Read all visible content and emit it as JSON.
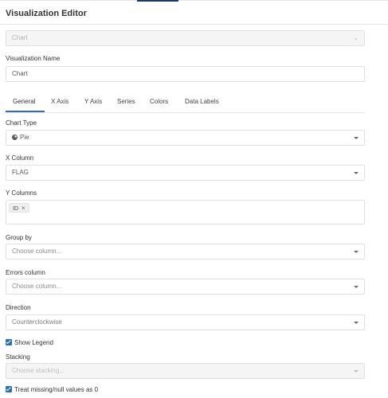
{
  "header": {
    "title": "Visualization Editor"
  },
  "query_result_select": {
    "value": "Chart"
  },
  "name_field": {
    "label": "Visualization Name",
    "value": "Chart"
  },
  "tabs": [
    {
      "label": "General",
      "active": true
    },
    {
      "label": "X Axis"
    },
    {
      "label": "Y Axis"
    },
    {
      "label": "Series"
    },
    {
      "label": "Colors"
    },
    {
      "label": "Data Labels"
    }
  ],
  "chart_type": {
    "label": "Chart Type",
    "value": "Pie",
    "icon": "pie-chart-icon"
  },
  "x_column": {
    "label": "X Column",
    "value": "FLAG"
  },
  "y_columns": {
    "label": "Y Columns",
    "tags": [
      "ID"
    ],
    "remove_symbol": "×"
  },
  "group_by": {
    "label": "Group by",
    "placeholder": "Choose column..."
  },
  "errors_column": {
    "label": "Errors column",
    "placeholder": "Choose column..."
  },
  "direction": {
    "label": "Direction",
    "value": "Counterclockwise"
  },
  "show_legend": {
    "label": "Show Legend",
    "checked": true
  },
  "stacking": {
    "label": "Stacking",
    "placeholder": "Choose stacking..."
  },
  "treat_missing": {
    "label": "Treat missing/null values as 0",
    "checked": true
  },
  "colors": {
    "accent": "#2a6fb5",
    "border": "#e0e0e0",
    "disabled_bg": "#f5f5f5"
  }
}
